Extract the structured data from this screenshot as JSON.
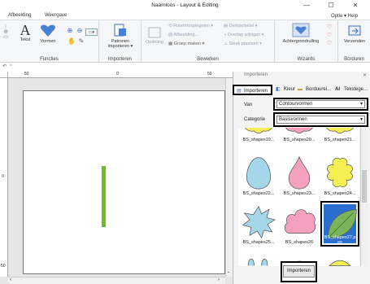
{
  "window": {
    "title": "Naamloos - Layout & Editing",
    "min": "—",
    "max": "☐",
    "close": "✕"
  },
  "menu": {
    "items": [
      "Afbeelding",
      "Weergave"
    ],
    "right": "Optie ▾ Help"
  },
  "ribbon": {
    "tekst": "Tekst",
    "vormen": "Vormen",
    "functies": "Functies",
    "patronen": "Patronen importeren ▾",
    "importeren": "Importeren",
    "opdeling": "Opdeling",
    "roteren": "Roteren/spiegelen ▾",
    "afbeelding": "Afbeelding...",
    "groep": "Groep maken ▾",
    "dempel": "Dempelselst ▾",
    "overlap": "Overlap wijzigen ▾",
    "steek": "Steek plaatsen ▾",
    "bewerken": "Bewerken",
    "achtergrond": "Achtergrondrulling",
    "wizards": "Wizards",
    "verzenden": "Verzenden",
    "borduren": "Borduren"
  },
  "rulers": {
    "h": [
      "50",
      "0",
      "50"
    ],
    "v": [
      "0",
      "50"
    ]
  },
  "panel": {
    "header": "Importeren",
    "tabs": [
      "Importeren",
      "Kleur",
      "Borduurei...",
      "Tekstege..."
    ],
    "van_label": "Van",
    "van_value": "Contourvormen",
    "categorie_label": "Categorie",
    "categorie_value": "Basisvormen",
    "shapes": [
      {
        "label": "BS_shapes19...",
        "kind": "cloud-partial",
        "color": "#f5ee55"
      },
      {
        "label": "BS_shapes20...",
        "kind": "cloud-partial",
        "color": "#f6a0c0"
      },
      {
        "label": "BS_shapes21...",
        "kind": "cloud-partial",
        "color": "#f5ee55"
      },
      {
        "label": "BS_shapes22...",
        "kind": "egg",
        "color": "#a6d6ea"
      },
      {
        "label": "BS_shapes23...",
        "kind": "drop",
        "color": "#f6a0c0"
      },
      {
        "label": "BS_shapes24...",
        "kind": "flower",
        "color": "#f5ee55"
      },
      {
        "label": "BS_shapes25...",
        "kind": "burst",
        "color": "#a6d6ea"
      },
      {
        "label": "BS_shapes26",
        "kind": "cloud",
        "color": "#f6a0c0"
      },
      {
        "label": "BS_shapes27.p es",
        "kind": "leaf",
        "color": "#7ab55c",
        "selected": true
      }
    ],
    "import_button": "Importeren"
  }
}
